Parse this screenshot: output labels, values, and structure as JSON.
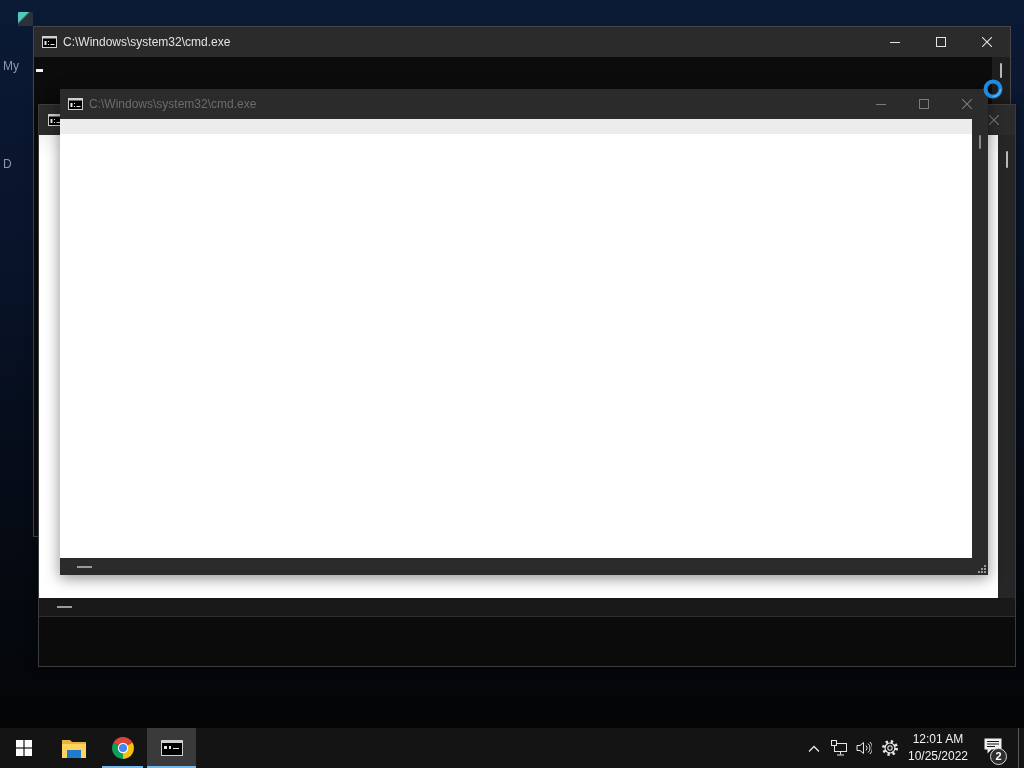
{
  "desktop": {
    "icons": [
      {
        "label": "My"
      },
      {
        "label": "D"
      }
    ]
  },
  "windows": [
    {
      "title": "C:\\Windows\\system32\\cmd.exe",
      "active": true
    },
    {
      "active": false
    },
    {
      "title": "C:\\Windows\\system32\\cmd.exe",
      "active": false
    }
  ],
  "taskbar": {
    "apps": [
      {
        "kind": "folder",
        "running": false,
        "active": false
      },
      {
        "kind": "browser",
        "running": true,
        "active": false
      },
      {
        "kind": "console",
        "running": true,
        "active": true
      }
    ],
    "clock": {
      "time": "12:01 AM",
      "date": "10/25/2022"
    },
    "notifications": {
      "count": "2"
    }
  }
}
